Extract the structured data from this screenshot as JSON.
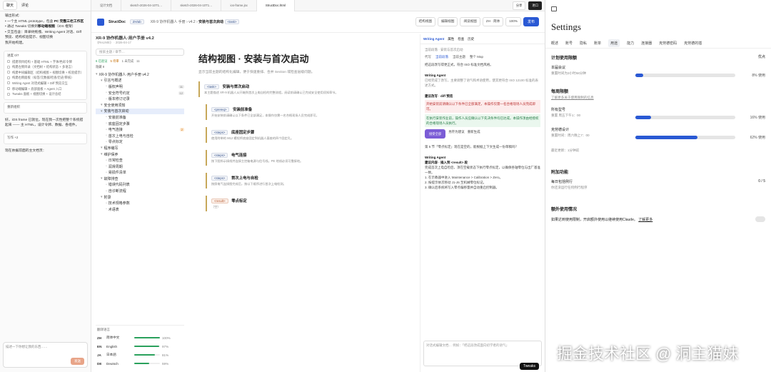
{
  "chat": {
    "tabs": [
      "聊天",
      "评论"
    ],
    "output_head": "输出形式:",
    "bullets": [
      [
        "一个主 HTML prototype，包含 ",
        "PC 完整三栏工作区"
      ],
      [
        "通过 Tweaks 切换到",
        "移动端视图",
        "（iOS 框架）"
      ],
      [
        "交互包含：目录树拖拽、Writing Agent 对话、Diff 预览、结构校验提示、视图切换"
      ]
    ],
    "plan_line": "我开始构建。",
    "todo_head": "进度 0/7",
    "todos": [
      "搭建项目结构 + 基础 HTML + 字体/色彩令牌",
      "构建左侧目录（文档树 + 结构状态 + 多语言）",
      "构建中间编辑区（结构视图 + 视图切换 + 校验提示）",
      "构建右侧面板（标签/元数据/检查/历史/审核）",
      "Writing Agent 对话式编辑 + Diff 预览交互",
      "移动端编辑 + 底部面板 + Agent 入口",
      "Tweaks 面板 + 视图切换 + 设计总结"
    ],
    "todo2_head": "重新组织",
    "note": "好，iOS frame 已就位。现在我一次性把整个系统搭起来 —— 主 HTML，设计令牌、数据、各组件。",
    "todo3_head": "写作 +2",
    "plan2": "现在依据前面的主文档页：",
    "input_placeholder": "描述一下你想让我的东西……",
    "send": "发送",
    "send2": "进口"
  },
  "app": {
    "top_tabs": [
      "设计文档",
      "sketch-2026-04-10T1…",
      "sketch-2026-04-10T1…",
      "ios-frame.jsx",
      "StructDoc.html"
    ],
    "top_right": [
      "分享",
      "进口"
    ],
    "brand": "StructDoc",
    "brand_tag": "ZH/ab",
    "breadcrumb": [
      "XR-9 协作机器人 手册",
      "v4.2",
      "安装与首次启动",
      "<task>"
    ],
    "view_buttons": [
      "结构视图",
      "编辑视图",
      "阅读视图"
    ],
    "lang_sel": "ZH · 简体",
    "publish": "发布",
    "zoom": "100%",
    "tree": {
      "title": "XR-9 协作机器人·用户手册 v4.2",
      "meta": "《ReLIME》 · 2026-04-17",
      "search": "搜索主题 / 章节…",
      "status": [
        "6 已验证",
        "5 待审",
        "1 未完成",
        "11"
      ],
      "status2": "隐藏 8",
      "nodes": [
        {
          "d": 0,
          "t": "XR-9 协作机器人·用户手册 v4.2",
          "b": ""
        },
        {
          "d": 1,
          "t": "引言与概述",
          "b": ""
        },
        {
          "d": 2,
          "t": "版权声明",
          "b": "11"
        },
        {
          "d": 2,
          "t": "安全符号约定",
          "b": "12"
        },
        {
          "d": 2,
          "t": "版本修订记录",
          "b": ""
        },
        {
          "d": 1,
          "t": "安全使用须知",
          "b": ""
        },
        {
          "d": 1,
          "t": "安装与首次启动",
          "b": "",
          "sel": true
        },
        {
          "d": 2,
          "t": "安装前准备",
          "b": ""
        },
        {
          "d": 2,
          "t": "底座固定步骤",
          "b": ""
        },
        {
          "d": 2,
          "t": "电气连接",
          "b": "2",
          "o": true
        },
        {
          "d": 2,
          "t": "首次上电与自检",
          "b": ""
        },
        {
          "d": 2,
          "t": "零点标定",
          "b": ""
        },
        {
          "d": 1,
          "t": "程序编写",
          "b": ""
        },
        {
          "d": 1,
          "t": "维护保养",
          "b": ""
        },
        {
          "d": 2,
          "t": "日常检查",
          "b": ""
        },
        {
          "d": 2,
          "t": "润滑周期",
          "b": ""
        },
        {
          "d": 2,
          "t": "易损件清单",
          "b": ""
        },
        {
          "d": 1,
          "t": "故障排查",
          "b": ""
        },
        {
          "d": 2,
          "t": "错误代码列表",
          "b": ""
        },
        {
          "d": 2,
          "t": "自诊断流程",
          "b": ""
        },
        {
          "d": 1,
          "t": "附录",
          "b": ""
        },
        {
          "d": 2,
          "t": "技术规格参数",
          "b": ""
        },
        {
          "d": 2,
          "t": "术语表",
          "b": ""
        }
      ],
      "lang_head": "翻译语言",
      "langs": [
        {
          "code": "ZH",
          "name": "简体中文",
          "pct": "100%",
          "v": 100
        },
        {
          "code": "EN",
          "name": "English",
          "pct": "97%",
          "v": 97
        },
        {
          "code": "JA",
          "name": "日本語",
          "pct": "81%",
          "v": 81
        },
        {
          "code": "DE",
          "name": "Deutsch",
          "pct": "59%",
          "v": 59
        }
      ]
    },
    "doc": {
      "title": "结构视图 · 安装与首次启动",
      "sub": "显示当前主题的结构化编辑，便于快速重排、合并 Section 或检查层级问题。",
      "sections": [
        {
          "tag": "<task>",
          "t": "安装与首次启动",
          "d": "本主题描述 XR-9 机器人从开箱到首次上电自检的完整流程。阅读前请确认已完成安全使用须知章节。",
          "sub": false
        },
        {
          "tag": "<prereq>",
          "t": "安装前准备",
          "d": "开始安装前请确认以下条件已全部满足，本操作仅需一名合格现场人员完成即可。",
          "sub": true
        },
        {
          "tag": "<steps>",
          "t": "底座固定步骤",
          "d": "使用附带的 M12 螺栓将底座固定到机器人基座的四个固定孔。",
          "sub": true
        },
        {
          "tag": "<steps>",
          "t": "电气连接",
          "d": "按下图所示接线并连接主控箱电源与信号线。PE 地线必须可靠接地。",
          "sub": true
        },
        {
          "tag": "<steps>",
          "t": "首次上电与自检",
          "d": "按照电气连接图完成后，按以下顺序进行首次上电检测。",
          "sub": true
        },
        {
          "tag": "<result>",
          "t": "零点标定",
          "d": "（空）",
          "sub": true,
          "r": true
        }
      ]
    },
    "agent": {
      "tabs": [
        "Writing Agent",
        "属性",
        "检查",
        "历史"
      ],
      "ctx": "当前段落 · 安装与首次启动",
      "modes": [
        "代写",
        "当前段落",
        "当前主题",
        "整个 Map"
      ],
      "m1": "把这段改写得更正式，符合 ISO 标准文档风格。",
      "agent_name": "Writing Agent",
      "m2": "已经完成了改写，主要调整了语气和术语使用，使其更符合 ISO 12100 标准的表述方式。",
      "diff_head": "建议改写 · diff 预览",
      "minus": "开始安装前请确认以下条件已全部满足，本操作仅需一名合格现场人员完成即可。",
      "plus": "在执行安装作业前，操作人员应确认以下先决条件均已达成。本操作须由经授权的合格现场人员执行。",
      "accept": [
        "接受全部",
        "另存为建议",
        "重新生成"
      ],
      "m3": "第 5 节「零点标定」现在是空的，能根据上下文生成一份草稿吗？",
      "m4_head": "建议内容 · 插入到 <result> 段",
      "m4": "完成首次上电自检后，须在空载状态下执行零点标定，以确保各轴零位与出厂基准一致。",
      "list": [
        "在示教器中进入 Maintenance > Calibration > Zero。",
        "按提示依次移动 J1-J6 至机械零位标记。",
        "确认后系统将写入零点偏移量并自动重启控制器。"
      ],
      "input": "对话式编辑文档… 例如：「把这段改成面向初学者的语气」",
      "tweaks": "Tweaks"
    }
  },
  "settings": {
    "title": "Settings",
    "tabs": [
      "概述",
      "账号",
      "隐私",
      "账单",
      "用途",
      "能力",
      "连接器",
      "克劳德密码",
      "克劳德的插"
    ],
    "sec1": "计划使用限额",
    "sec1_right": "优点",
    "cur_label": "本届会议",
    "cur_sub": "重置时间为3小时58分钟",
    "cur_pct": "8% 使用",
    "cur_v": 8,
    "sec2": "每周限额",
    "sec2_link": "了解更多关于使用限制的信息",
    "w1": "所有型号",
    "w1_sub": "重置 周五下午1：00",
    "w1_pct": "16% 使用",
    "w1_v": 16,
    "w2": "克劳德设计",
    "w2_sub": "重置时间：周六晚上7：00",
    "w2_pct": "62% 使用",
    "w2_v": 62,
    "updated": "最近更新：1分钟前",
    "sec3": "附加功能",
    "f1": "每日包括例行",
    "f1_sub": "你还没运行任何例行程序",
    "f1_val": "0 / 5",
    "sec4": "额外使用情况",
    "f2": "如果达到使用限制，开启额外使用以继续使用Claude。",
    "f2_link": "了解更多"
  },
  "watermark": "掘金技术社区 @ 洞主猫妹",
  "colors": {
    "accent": "#2a59d4",
    "green": "#2aa15c"
  }
}
